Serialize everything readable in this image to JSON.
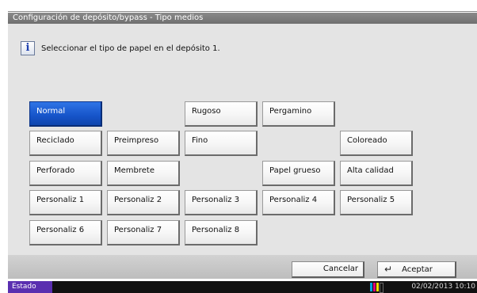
{
  "title": "Configuración de depósito/bypass - Tipo medios",
  "info": {
    "icon": "info-icon",
    "glyph": "i",
    "text": "Seleccionar el tipo de papel en el depósito 1."
  },
  "media_types": [
    {
      "label": "Normal",
      "selected": true
    },
    {
      "label": "Rugoso"
    },
    {
      "label": "Pergamino"
    },
    {
      "label": "Reciclado"
    },
    {
      "label": "Preimpreso"
    },
    {
      "label": "Fino"
    },
    {
      "label": "Coloreado"
    },
    {
      "label": "Perforado"
    },
    {
      "label": "Membrete"
    },
    {
      "label": "Papel grueso"
    },
    {
      "label": "Alta calidad"
    },
    {
      "label": "Personaliz 1"
    },
    {
      "label": "Personaliz 2"
    },
    {
      "label": "Personaliz 3"
    },
    {
      "label": "Personaliz 4"
    },
    {
      "label": "Personaliz 5"
    },
    {
      "label": "Personaliz 6"
    },
    {
      "label": "Personaliz 7"
    },
    {
      "label": "Personaliz 8"
    }
  ],
  "footer": {
    "cancel_label": "Cancelar",
    "accept_label": "Aceptar",
    "accept_icon": "enter-icon"
  },
  "status": {
    "label": "Estado",
    "datetime": "02/02/2013  10:10",
    "toner_icon": "toner-icon"
  },
  "colors": {
    "selected": "#1654c9",
    "status_accent": "#5a2fb0",
    "toner": [
      "#00a0e0",
      "#e0007a",
      "#f5e000",
      "#111111"
    ]
  }
}
